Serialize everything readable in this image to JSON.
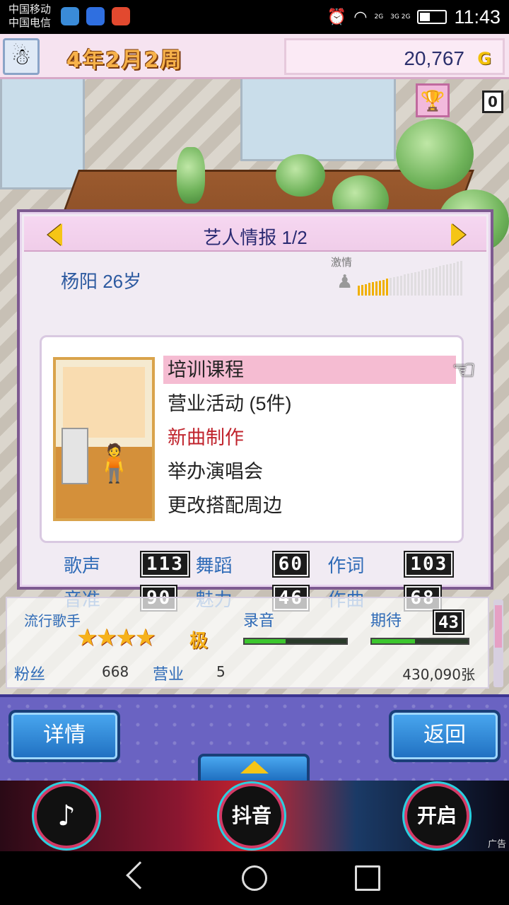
{
  "status_bar": {
    "carrier1": "中国移动",
    "carrier2": "中国电信",
    "time": "11:43",
    "net1": "2G",
    "net2": "3G 2G"
  },
  "hud": {
    "date": "4年2月2周",
    "money": "20,767",
    "currency": "G",
    "trophy_count": "0"
  },
  "panel": {
    "title": "艺人情报 1/2",
    "artist": "杨阳 26岁",
    "passion_label": "激情",
    "passion_level": 0.3,
    "menu": [
      {
        "label": "培训课程"
      },
      {
        "label": "营业活动 (5件)"
      },
      {
        "label": "新曲制作"
      },
      {
        "label": "举办演唱会"
      },
      {
        "label": "更改搭配周边"
      }
    ],
    "stats": {
      "singing_label": "歌声",
      "singing": "113",
      "dance_label": "舞蹈",
      "dance": "60",
      "lyrics_label": "作词",
      "lyrics": "103",
      "pitch_label": "音准",
      "pitch": "90",
      "charm_label": "魅力",
      "charm": "46",
      "compose_label": "作曲",
      "compose": "68"
    }
  },
  "info": {
    "genre": "流行歌手",
    "rank": "极",
    "rank_stars": 4,
    "rec_label": "录音",
    "rec_progress": 0.4,
    "expect_label": "期待",
    "expect": "43",
    "expect_progress": 0.45,
    "fans_label": "粉丝",
    "fans": "668",
    "biz_label": "营业",
    "biz": "5",
    "sales": "430,090张"
  },
  "buttons": {
    "detail": "详情",
    "back": "返回"
  },
  "ad": {
    "btn1_icon": "tiktok-logo",
    "btn2": "抖音",
    "btn3": "开启",
    "tag": "广告"
  },
  "colors": {
    "panel_border": "#7d5a90",
    "label_blue": "#2f6bb7",
    "highlight_pink": "#f5bcd2",
    "red_text": "#c0232c"
  }
}
